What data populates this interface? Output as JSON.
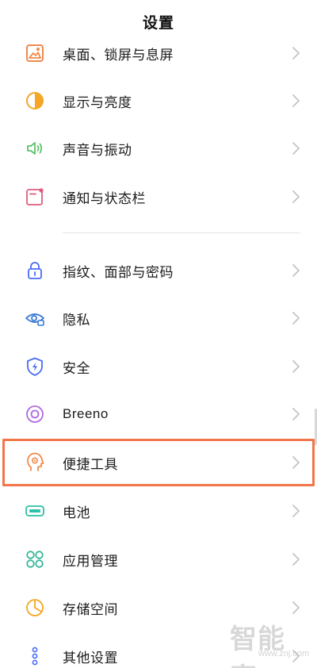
{
  "header": {
    "title": "设置"
  },
  "colors": {
    "highlight": "#f2764a",
    "wallpaper_icon": "#f08a4b",
    "display_icon": "#f5a623",
    "sound_icon": "#5cc26b",
    "notify_icon": "#e05c7e",
    "lock_icon": "#4a6cf7",
    "privacy_icon": "#3a7bd5",
    "security_icon": "#4a6cf7",
    "breeno_icon": "#b06ae0",
    "tools_icon": "#f08a4b",
    "battery_icon": "#2bc0a8",
    "apps_icon": "#35b89a",
    "storage_icon": "#f5a623",
    "other_icon": "#4a6cf7"
  },
  "settings": {
    "items": [
      {
        "label": "桌面、锁屏与息屏",
        "icon": "wallpaper-icon"
      },
      {
        "label": "显示与亮度",
        "icon": "brightness-icon"
      },
      {
        "label": "声音与振动",
        "icon": "speaker-icon"
      },
      {
        "label": "通知与状态栏",
        "icon": "notification-icon"
      },
      {
        "label": "指纹、面部与密码",
        "icon": "lock-icon"
      },
      {
        "label": "隐私",
        "icon": "privacy-eye-icon"
      },
      {
        "label": "安全",
        "icon": "shield-icon"
      },
      {
        "label": "Breeno",
        "icon": "breeno-icon"
      },
      {
        "label": "便捷工具",
        "icon": "convenience-tools-icon"
      },
      {
        "label": "电池",
        "icon": "battery-icon"
      },
      {
        "label": "应用管理",
        "icon": "app-grid-icon"
      },
      {
        "label": "存储空间",
        "icon": "storage-pie-icon"
      },
      {
        "label": "其他设置",
        "icon": "more-dots-icon"
      }
    ]
  },
  "watermark": {
    "brand": "智能家",
    "url": "www.znj.com"
  }
}
